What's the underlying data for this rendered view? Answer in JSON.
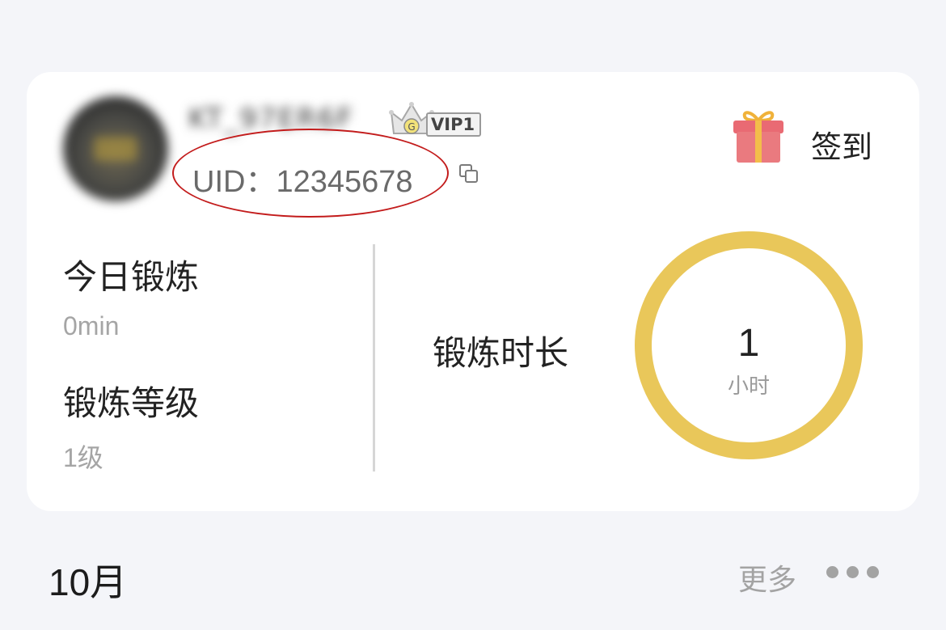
{
  "profile": {
    "nickname": "KT_97ER6F",
    "vip_label": "VIP1",
    "uid_text": "UID：12345678"
  },
  "signin": {
    "label": "签到"
  },
  "stats": {
    "today_title": "今日锻炼",
    "today_value": "0min",
    "level_title": "锻炼等级",
    "level_value": "1级",
    "duration_title": "锻炼时长",
    "duration_value": "1",
    "duration_unit": "小时"
  },
  "footer": {
    "month": "10月",
    "more_label": "更多"
  },
  "icons": {
    "avatar": "avatar-icon",
    "vip": "crown-icon",
    "copy": "copy-icon",
    "gift": "gift-icon",
    "more": "more-dots-icon"
  },
  "colors": {
    "ring": "#e9c75a",
    "annotation_circle": "#c31c1c",
    "gift": "#ea7a7f"
  }
}
